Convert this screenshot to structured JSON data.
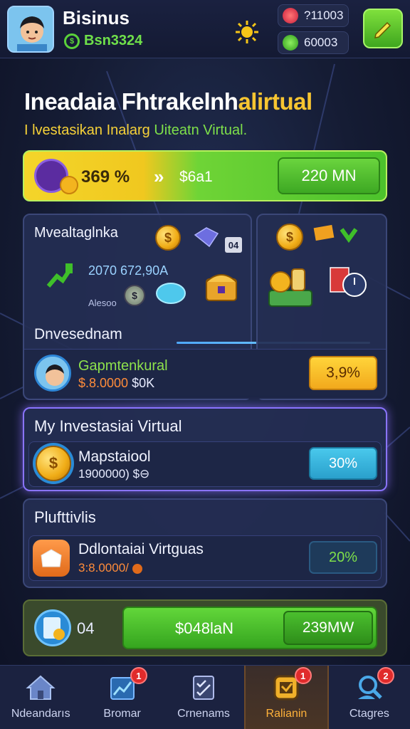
{
  "header": {
    "username": "Bisinus",
    "balance": "Bsn3324",
    "stat1": "?11003",
    "stat2": "60003"
  },
  "hero": {
    "title_main": "Ineadaia Fhtrakelnh",
    "title_accent": "alirtual",
    "subtitle_yellow": "I lvestasikan Inalarg",
    "subtitle_green": "Uiteatn Virtual."
  },
  "banner": {
    "amount": "369 %",
    "value": "$6a1",
    "button": "220 MN"
  },
  "panel_left": {
    "title": "Mvealtaglnka",
    "box_label": "04",
    "stat": "2070 672,90A",
    "small": "Alesoo",
    "section": "Dnvesednam"
  },
  "top_row": {
    "name": "Gapmtenkural",
    "amount": "$.8.0000",
    "amount_suffix": "$0K",
    "button": "3,9%"
  },
  "investasi": {
    "title": "My Investasiai Virtual",
    "name": "Mapstaiool",
    "amount": "1900000)",
    "amount_suffix": "$⊖",
    "button": "30%"
  },
  "portfolio": {
    "title": "Plufttivlis",
    "name": "Ddlontaiai Virtguas",
    "amount": "3:8.0000/",
    "button": "20%"
  },
  "bottom_banner": {
    "count": "04",
    "value": "$048laN",
    "button": "239MW"
  },
  "tabs": [
    {
      "label": "Ndeandarıs",
      "badge": "",
      "icon": "home-icon"
    },
    {
      "label": "Bromar",
      "badge": "1",
      "icon": "chart-icon"
    },
    {
      "label": "Crnenams",
      "badge": "",
      "icon": "checklist-icon"
    },
    {
      "label": "Ralianin",
      "badge": "1",
      "icon": "rank-icon"
    },
    {
      "label": "Ctagres",
      "badge": "2",
      "icon": "search-user-icon"
    }
  ],
  "colors": {
    "accent_green": "#4cc22c",
    "accent_yellow": "#f7c531",
    "background": "#151c34"
  }
}
